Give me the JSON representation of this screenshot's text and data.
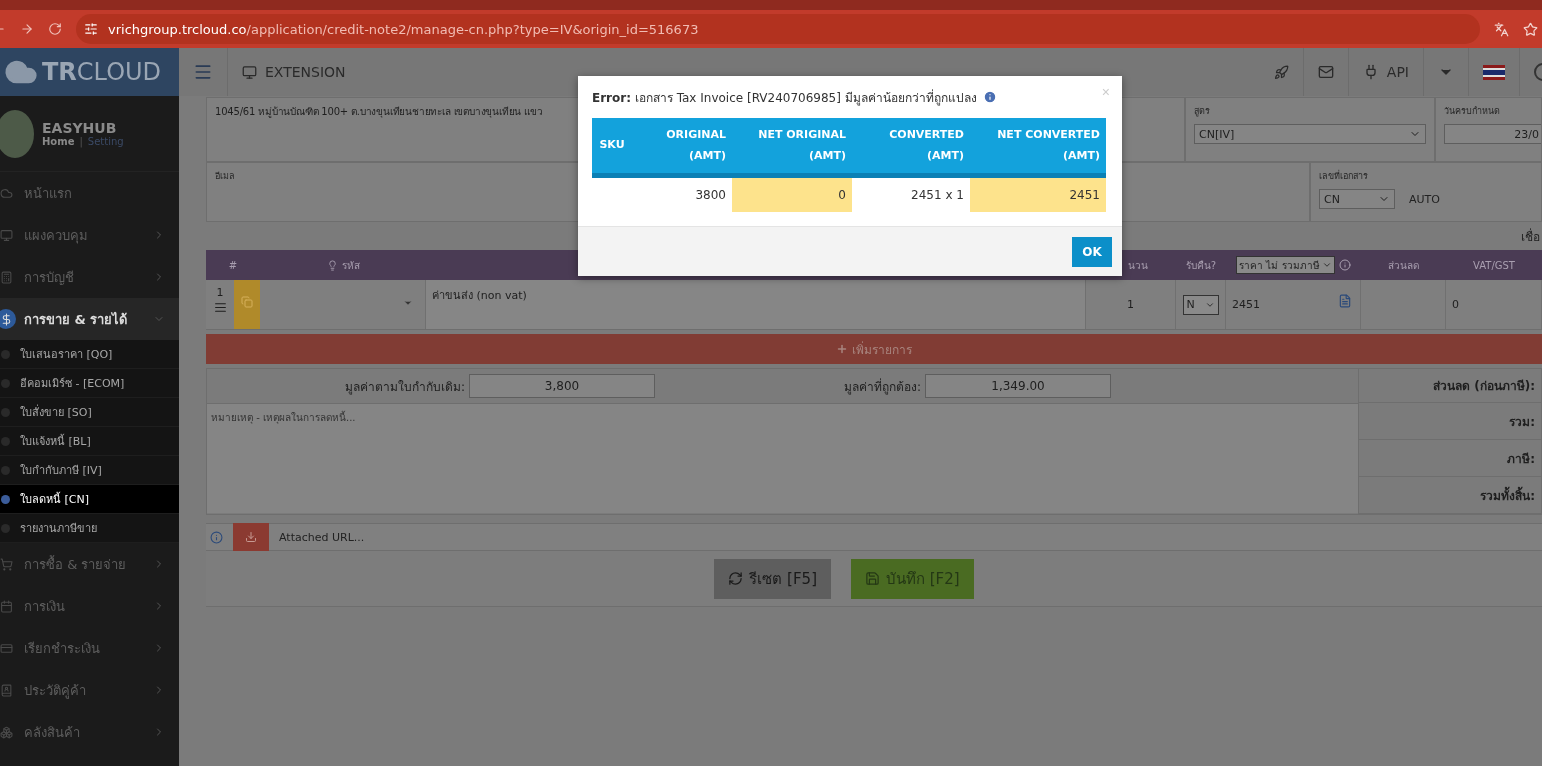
{
  "browser": {
    "url_host": "vrichgroup.trcloud.co",
    "url_path": "/application/credit-note2/manage-cn.php?type=IV&origin_id=516673"
  },
  "header": {
    "logo": "**TR**CLOUD",
    "extension": "EXTENSION",
    "api": "API"
  },
  "profile": {
    "name": "EASYHUB",
    "home": "Home",
    "separator": "|",
    "setting": "Setting"
  },
  "sidebar": {
    "items": [
      {
        "label": "หน้าแรก",
        "kind": "link"
      },
      {
        "label": "แผงควบคุม",
        "kind": "menu",
        "expanded": false
      },
      {
        "label": "การบัญชี",
        "kind": "menu",
        "expanded": false
      },
      {
        "label": "การขาย & รายได้",
        "kind": "menu",
        "expanded": true,
        "children": [
          {
            "label": "ใบเสนอราคา [QO]",
            "selected": false
          },
          {
            "label": "อีคอมเมิร์ซ - [ECOM]",
            "selected": false
          },
          {
            "label": "ใบสั่งขาย [SO]",
            "selected": false
          },
          {
            "label": "ใบแจ้งหนี้ [BL]",
            "selected": false
          },
          {
            "label": "ใบกำกับภาษี [IV]",
            "selected": false
          },
          {
            "label": "ใบลดหนี้ [CN]",
            "selected": true
          },
          {
            "label": "รายงานภาษีขาย",
            "selected": false
          }
        ]
      },
      {
        "label": "การซื้อ & รายจ่าย",
        "kind": "menu",
        "expanded": false
      },
      {
        "label": "การเงิน",
        "kind": "menu",
        "expanded": false
      },
      {
        "label": "เรียกชำระเงิน",
        "kind": "menu",
        "expanded": false
      },
      {
        "label": "ประวัติคู่ค้า",
        "kind": "menu",
        "expanded": false
      },
      {
        "label": "คลังสินค้า",
        "kind": "menu",
        "expanded": false
      }
    ]
  },
  "form": {
    "address": "1045/61 หมู่บ้านบัณฑิต 100+ ต.บางขุนเทียนชายทะเล เขตบางขุนเทียน แขว",
    "formula": {
      "label": "สูตร",
      "value": "CN[IV]"
    },
    "due_date": {
      "label": "วันครบกำหนด",
      "value": "23/0"
    },
    "email": {
      "label": "อีเมล"
    },
    "doc_number": {
      "label": "เลขที่เอกสาร",
      "value": "CN",
      "mode": "AUTO"
    },
    "edge_text": "เชื่อ"
  },
  "items": {
    "header": {
      "number": "#",
      "code": "รหัส",
      "quantity": "นวน",
      "returned": "รับคืน?",
      "price_mode": "ราคา ไม่ รวมภาษี",
      "discount": "ส่วนลด",
      "vat": "VAT/GST"
    },
    "rows": [
      {
        "number": "1",
        "description": "ค่าขนส่ง (non vat)",
        "quantity": "1",
        "returned": "N",
        "price": "2451",
        "vat": "0"
      }
    ],
    "add_button": "เพิ่มรายการ"
  },
  "summary": {
    "original_label": "มูลค่าตามใบกำกับเดิม:",
    "original_value": "3,800",
    "correct_label": "มูลค่าที่ถูกต้อง:",
    "correct_value": "1,349.00",
    "remarks_placeholder": "หมายเหตุ - เหตุผลในการลดหนี้...",
    "totals": [
      "ส่วนลด (ก่อนภาษี):",
      "รวม:",
      "ภาษี:",
      "รวมทั้งสิ้น:"
    ]
  },
  "attachment": {
    "placeholder": "Attached URL..."
  },
  "actions": {
    "reset": "รีเซต [F5]",
    "save": "บันทึก [F2]"
  },
  "modal": {
    "title": "**Error:** เอกสาร Tax Invoice [RV240706985] มีมูลค่าน้อยกว่าที่ถูกแปลง",
    "close": "×",
    "columns": [
      "SKU",
      "ORIGINAL\n(AMT)",
      "NET ORIGINAL\n(AMT)",
      "CONVERTED\n(AMT)",
      "NET CONVERTED\n(AMT)"
    ],
    "rows": [
      {
        "cells": [
          {
            "highlight": false
          },
          {
            "text": "3800",
            "highlight": false
          },
          {
            "text": "0",
            "highlight": true
          },
          {
            "text": "2451 x 1",
            "highlight": false
          },
          {
            "text": "2451",
            "highlight": true
          }
        ]
      }
    ],
    "ok": "OK"
  }
}
